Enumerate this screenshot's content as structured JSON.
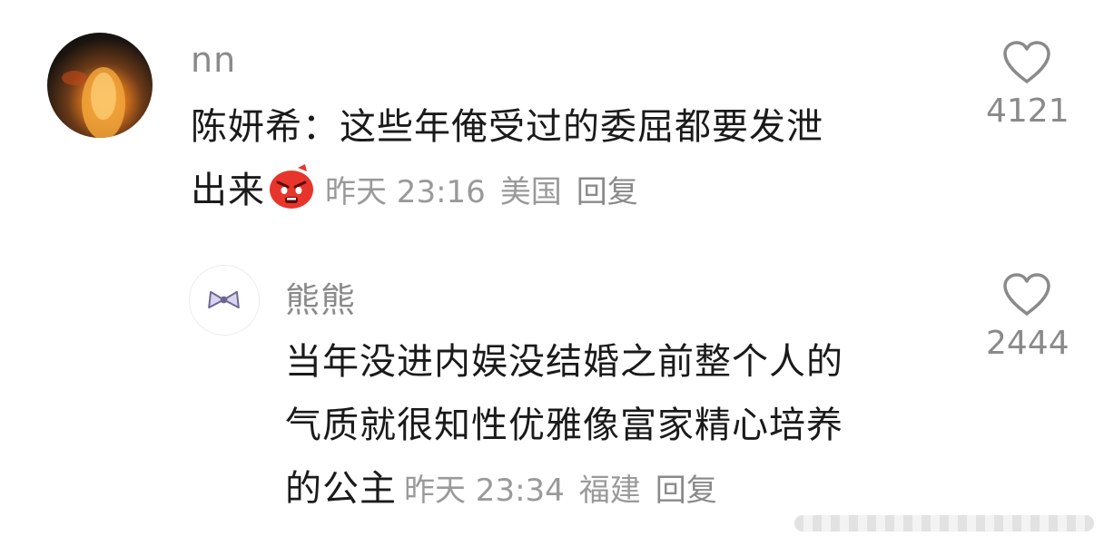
{
  "comments": [
    {
      "username": "nn",
      "text_line1": "陈妍希：这些年俺受过的委屈都要发泄",
      "text_line2": "出来",
      "emoji_icon": "angry-red-face-emoji",
      "time": "昨天 23:16",
      "location": "美国",
      "reply_label": "回复",
      "likes": "4121"
    },
    {
      "username": "熊熊",
      "text_line1": "当年没进内娱没结婚之前整个人的",
      "text_line2": "气质就很知性优雅像富家精心培养",
      "text_line3": "的公主",
      "time": "昨天 23:34",
      "location": "福建",
      "reply_label": "回复",
      "likes": "2444",
      "avatar_icon": "bow-ribbon-icon"
    }
  ],
  "colors": {
    "text": "#1a1a1a",
    "muted": "#8a8a8a",
    "meta": "#9a9a9a"
  }
}
